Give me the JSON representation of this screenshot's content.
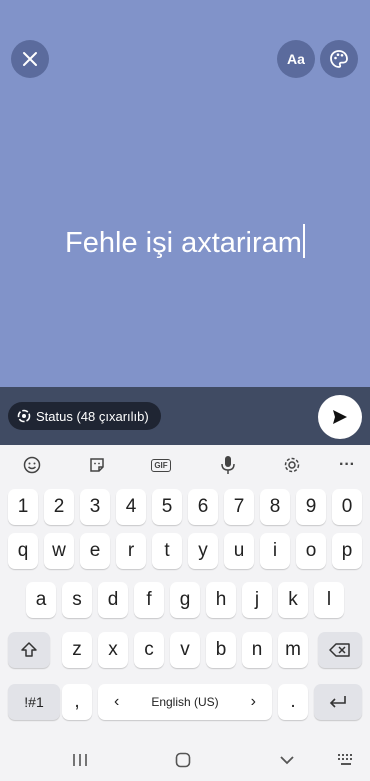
{
  "composer": {
    "background": "#8193c9",
    "status_text": "Fehle işi axtariram",
    "font_button_label": "Aa"
  },
  "bottom_bar": {
    "audience_label": "Status (48 çıxarılıb)"
  },
  "keyboard": {
    "toolbar_icons": [
      "emoji-icon",
      "sticker-icon",
      "gif-icon",
      "microphone-icon",
      "gear-icon",
      "more-icon"
    ],
    "gif_label": "GIF",
    "more_label": "···",
    "numbers": [
      "1",
      "2",
      "3",
      "4",
      "5",
      "6",
      "7",
      "8",
      "9",
      "0"
    ],
    "row1": [
      "q",
      "w",
      "e",
      "r",
      "t",
      "y",
      "u",
      "i",
      "o",
      "p"
    ],
    "row2": [
      "a",
      "s",
      "d",
      "f",
      "g",
      "h",
      "j",
      "k",
      "l"
    ],
    "row3": [
      "z",
      "x",
      "c",
      "v",
      "b",
      "n",
      "m"
    ],
    "symbols_label": "!#1",
    "comma_label": ",",
    "space_label": "English (US)",
    "space_left_arrow": "‹",
    "space_right_arrow": "›",
    "period_label": "."
  }
}
